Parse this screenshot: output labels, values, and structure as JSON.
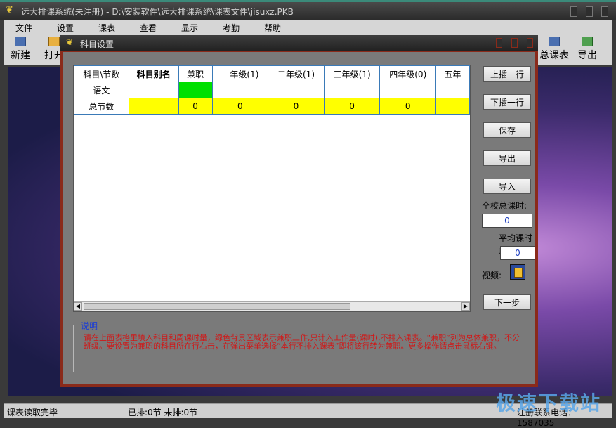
{
  "window": {
    "title": "远大排课系统(未注册) - D:\\安装软件\\远大排课系统\\课表文件\\jisuxz.PKB"
  },
  "menu": [
    "文件",
    "设置",
    "课表",
    "查看",
    "显示",
    "考勤",
    "帮助"
  ],
  "toolbar": {
    "new_label": "新建",
    "open_label": "打开",
    "total_label": "总课表",
    "export_label": "导出"
  },
  "status": {
    "left": "课表读取完毕",
    "middle": "已排:0节 未排:0节",
    "right": "注册联系电话：1587035"
  },
  "watermark": "极速下载站",
  "dialog": {
    "title": "科目设置",
    "grid": {
      "headers": [
        "科目\\节数",
        "科目别名",
        "兼职",
        "一年级(1)",
        "二年级(1)",
        "三年级(1)",
        "四年级(0)",
        "五年"
      ],
      "rows": [
        [
          "语文",
          "",
          "",
          "",
          "",
          "",
          "",
          ""
        ],
        [
          "总节数",
          "",
          "0",
          "0",
          "0",
          "0",
          "0",
          ""
        ]
      ]
    },
    "buttons": {
      "insert_above": "上插一行",
      "insert_below": "下插一行",
      "save": "保存",
      "export": "导出",
      "import": "导入",
      "next": "下一步"
    },
    "total_hours_label": "全校总课时:",
    "total_hours_value": "0",
    "avg_hours_label": "平均课时量",
    "avg_hours_value": "0",
    "video_label": "视频:",
    "desc_title": "说明",
    "desc_text": "请在上面表格里填入科目和周课时量，绿色背景区域表示兼职工作,只计入工作量(课时),不排入课表。“兼职”列为总体兼职，不分班级。要设置为兼职的科目所在行右击，在弹出菜单选择“本行不排入课表”即将该行转为兼职。更多操作请点击鼠标右键。"
  },
  "colors": {
    "green_cell": "#00e000",
    "yellow_cell": "#ffff00",
    "grid_border": "#3a7ab8",
    "dialog_frame": "#8a2a1a"
  }
}
